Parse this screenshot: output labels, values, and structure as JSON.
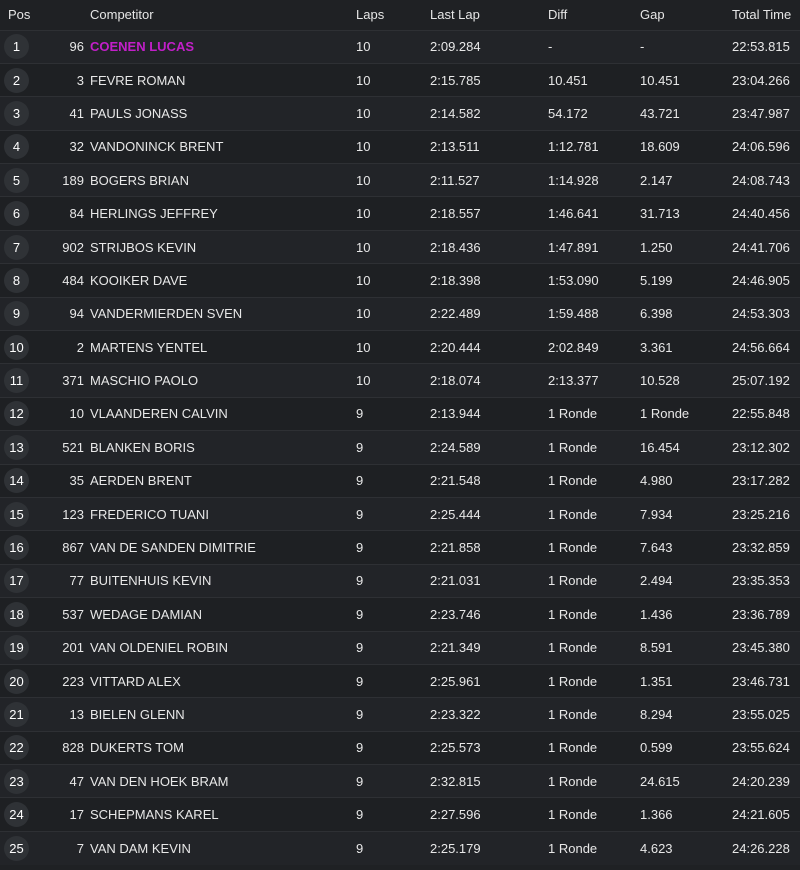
{
  "headers": {
    "pos": "Pos",
    "competitor": "Competitor",
    "laps": "Laps",
    "last_lap": "Last Lap",
    "diff": "Diff",
    "gap": "Gap",
    "total_time": "Total Time"
  },
  "colors": {
    "leader": "#c21fc9",
    "background": "#1f2124"
  },
  "rows": [
    {
      "pos": "1",
      "num": "96",
      "name": "COENEN LUCAS",
      "laps": "10",
      "last": "2:09.284",
      "diff": "-",
      "gap": "-",
      "total": "22:53.815"
    },
    {
      "pos": "2",
      "num": "3",
      "name": "FEVRE ROMAN",
      "laps": "10",
      "last": "2:15.785",
      "diff": "10.451",
      "gap": "10.451",
      "total": "23:04.266"
    },
    {
      "pos": "3",
      "num": "41",
      "name": "PAULS JONASS",
      "laps": "10",
      "last": "2:14.582",
      "diff": "54.172",
      "gap": "43.721",
      "total": "23:47.987"
    },
    {
      "pos": "4",
      "num": "32",
      "name": "VANDONINCK BRENT",
      "laps": "10",
      "last": "2:13.511",
      "diff": "1:12.781",
      "gap": "18.609",
      "total": "24:06.596"
    },
    {
      "pos": "5",
      "num": "189",
      "name": "BOGERS BRIAN",
      "laps": "10",
      "last": "2:11.527",
      "diff": "1:14.928",
      "gap": "2.147",
      "total": "24:08.743"
    },
    {
      "pos": "6",
      "num": "84",
      "name": "HERLINGS JEFFREY",
      "laps": "10",
      "last": "2:18.557",
      "diff": "1:46.641",
      "gap": "31.713",
      "total": "24:40.456"
    },
    {
      "pos": "7",
      "num": "902",
      "name": "STRIJBOS KEVIN",
      "laps": "10",
      "last": "2:18.436",
      "diff": "1:47.891",
      "gap": "1.250",
      "total": "24:41.706"
    },
    {
      "pos": "8",
      "num": "484",
      "name": "KOOIKER DAVE",
      "laps": "10",
      "last": "2:18.398",
      "diff": "1:53.090",
      "gap": "5.199",
      "total": "24:46.905"
    },
    {
      "pos": "9",
      "num": "94",
      "name": "VANDERMIERDEN SVEN",
      "laps": "10",
      "last": "2:22.489",
      "diff": "1:59.488",
      "gap": "6.398",
      "total": "24:53.303"
    },
    {
      "pos": "10",
      "num": "2",
      "name": "MARTENS YENTEL",
      "laps": "10",
      "last": "2:20.444",
      "diff": "2:02.849",
      "gap": "3.361",
      "total": "24:56.664"
    },
    {
      "pos": "11",
      "num": "371",
      "name": "MASCHIO PAOLO",
      "laps": "10",
      "last": "2:18.074",
      "diff": "2:13.377",
      "gap": "10.528",
      "total": "25:07.192"
    },
    {
      "pos": "12",
      "num": "10",
      "name": "VLAANDEREN CALVIN",
      "laps": "9",
      "last": "2:13.944",
      "diff": "1 Ronde",
      "gap": "1 Ronde",
      "total": "22:55.848"
    },
    {
      "pos": "13",
      "num": "521",
      "name": "BLANKEN BORIS",
      "laps": "9",
      "last": "2:24.589",
      "diff": "1 Ronde",
      "gap": "16.454",
      "total": "23:12.302"
    },
    {
      "pos": "14",
      "num": "35",
      "name": "AERDEN BRENT",
      "laps": "9",
      "last": "2:21.548",
      "diff": "1 Ronde",
      "gap": "4.980",
      "total": "23:17.282"
    },
    {
      "pos": "15",
      "num": "123",
      "name": "FREDERICO TUANI",
      "laps": "9",
      "last": "2:25.444",
      "diff": "1 Ronde",
      "gap": "7.934",
      "total": "23:25.216"
    },
    {
      "pos": "16",
      "num": "867",
      "name": "VAN DE SANDEN DIMITRIE",
      "laps": "9",
      "last": "2:21.858",
      "diff": "1 Ronde",
      "gap": "7.643",
      "total": "23:32.859"
    },
    {
      "pos": "17",
      "num": "77",
      "name": "BUITENHUIS KEVIN",
      "laps": "9",
      "last": "2:21.031",
      "diff": "1 Ronde",
      "gap": "2.494",
      "total": "23:35.353"
    },
    {
      "pos": "18",
      "num": "537",
      "name": "WEDAGE DAMIAN",
      "laps": "9",
      "last": "2:23.746",
      "diff": "1 Ronde",
      "gap": "1.436",
      "total": "23:36.789"
    },
    {
      "pos": "19",
      "num": "201",
      "name": "VAN OLDENIEL ROBIN",
      "laps": "9",
      "last": "2:21.349",
      "diff": "1 Ronde",
      "gap": "8.591",
      "total": "23:45.380"
    },
    {
      "pos": "20",
      "num": "223",
      "name": "VITTARD ALEX",
      "laps": "9",
      "last": "2:25.961",
      "diff": "1 Ronde",
      "gap": "1.351",
      "total": "23:46.731"
    },
    {
      "pos": "21",
      "num": "13",
      "name": "BIELEN GLENN",
      "laps": "9",
      "last": "2:23.322",
      "diff": "1 Ronde",
      "gap": "8.294",
      "total": "23:55.025"
    },
    {
      "pos": "22",
      "num": "828",
      "name": "DUKERTS TOM",
      "laps": "9",
      "last": "2:25.573",
      "diff": "1 Ronde",
      "gap": "0.599",
      "total": "23:55.624"
    },
    {
      "pos": "23",
      "num": "47",
      "name": "VAN DEN HOEK BRAM",
      "laps": "9",
      "last": "2:32.815",
      "diff": "1 Ronde",
      "gap": "24.615",
      "total": "24:20.239"
    },
    {
      "pos": "24",
      "num": "17",
      "name": "SCHEPMANS KAREL",
      "laps": "9",
      "last": "2:27.596",
      "diff": "1 Ronde",
      "gap": "1.366",
      "total": "24:21.605"
    },
    {
      "pos": "25",
      "num": "7",
      "name": "VAN DAM KEVIN",
      "laps": "9",
      "last": "2:25.179",
      "diff": "1 Ronde",
      "gap": "4.623",
      "total": "24:26.228"
    }
  ]
}
